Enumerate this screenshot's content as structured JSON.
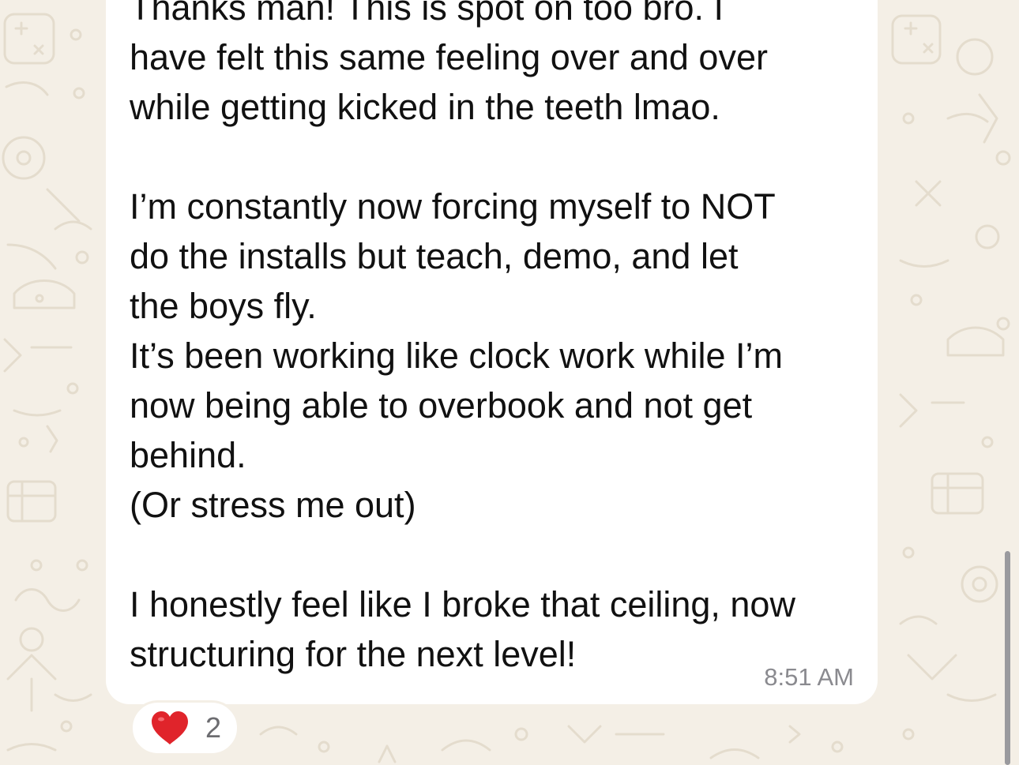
{
  "colors": {
    "wallpaper": "#f4efe6",
    "doodle": "#e4dccd",
    "bubble": "#ffffff",
    "text": "#111111",
    "timestamp": "#8a8a8f",
    "heart": "#e0242b"
  },
  "message": {
    "text": "Thanks man! This is spot on too bro. I\nhave felt this same feeling over and over\nwhile getting kicked in the teeth lmao.\n\nI’m constantly now forcing myself to NOT\ndo the installs but teach, demo, and let\nthe boys fly.\nIt’s been working like clock work while I’m\nnow being able to overbook and not get\nbehind.\n(Or stress me out)\n\nI honestly feel like I broke that ceiling, now\nstructuring for the next level!",
    "time": "8:51 AM"
  },
  "reaction": {
    "icon": "heart-icon",
    "count": "2"
  }
}
